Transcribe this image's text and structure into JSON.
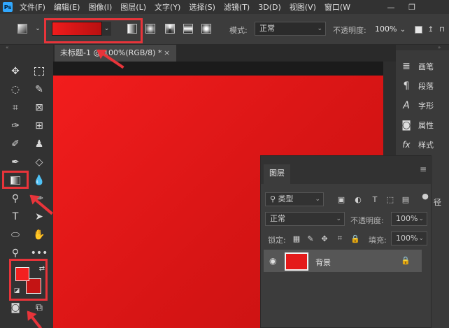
{
  "menubar": {
    "app_icon": "Ps",
    "items": [
      "文件(F)",
      "编辑(E)",
      "图像(I)",
      "图层(L)",
      "文字(Y)",
      "选择(S)",
      "滤镜(T)",
      "3D(D)",
      "视图(V)",
      "窗口(W"
    ],
    "minimize": "—",
    "restore": "❐"
  },
  "options": {
    "mode_label": "模式:",
    "mode_value": "正常",
    "opacity_label": "不透明度:",
    "opacity_value": "100%",
    "gradient_colors": [
      "#f01c1c",
      "#b81010"
    ]
  },
  "document": {
    "tab_title": "未标题-1 @ 100%(RGB/8) *",
    "close": "×"
  },
  "tools": {
    "foreground_color": "#f22020",
    "background_color": "#c41414"
  },
  "right_dock": {
    "items": [
      {
        "icon": "brush-icon",
        "label": "画笔"
      },
      {
        "icon": "paragraph-icon",
        "label": "段落"
      },
      {
        "icon": "character-icon",
        "label": "字形"
      },
      {
        "icon": "properties-icon",
        "label": "属性"
      },
      {
        "icon": "fx-icon",
        "label": "样式"
      }
    ],
    "partial_label": "径"
  },
  "layers_panel": {
    "tab": "图层",
    "filter_kind": "类型",
    "blend_mode": "正常",
    "opacity_label": "不透明度:",
    "opacity_value": "100%",
    "lock_label": "锁定:",
    "fill_label": "填充:",
    "fill_value": "100%",
    "layer": {
      "name": "背景",
      "thumbnail_color": "#e41a1a"
    }
  },
  "annotations": {
    "highlight_color": "#e8343a"
  }
}
